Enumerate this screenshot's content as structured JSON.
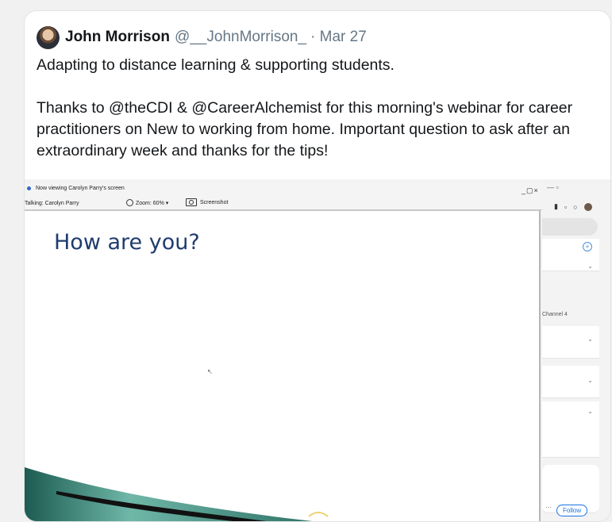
{
  "tweet": {
    "author_name": "John Morrison",
    "author_handle": "@__JohnMorrison_",
    "date": "· Mar 27",
    "paragraph1": "Adapting to distance learning & supporting students.",
    "paragraph2": "Thanks to @theCDI & @CareerAlchemist for this morning's webinar for career practitioners on New to working from home. Important question to ask after an extraordinary week and thanks for the tips!"
  },
  "screen": {
    "viewing_label": "Now viewing Carolyn Parry's screen",
    "talking_label": "Talking: Carolyn Parry",
    "zoom_label": "Zoom: 60% ▾",
    "screenshot_label": "Screenshot",
    "window_controls": "_▢×",
    "slide_title": "How are you?",
    "side_controls": "— ▫",
    "side_channel": "Channel 4",
    "follow_label": "Follow",
    "plus_symbol": "+",
    "dash": "···"
  }
}
